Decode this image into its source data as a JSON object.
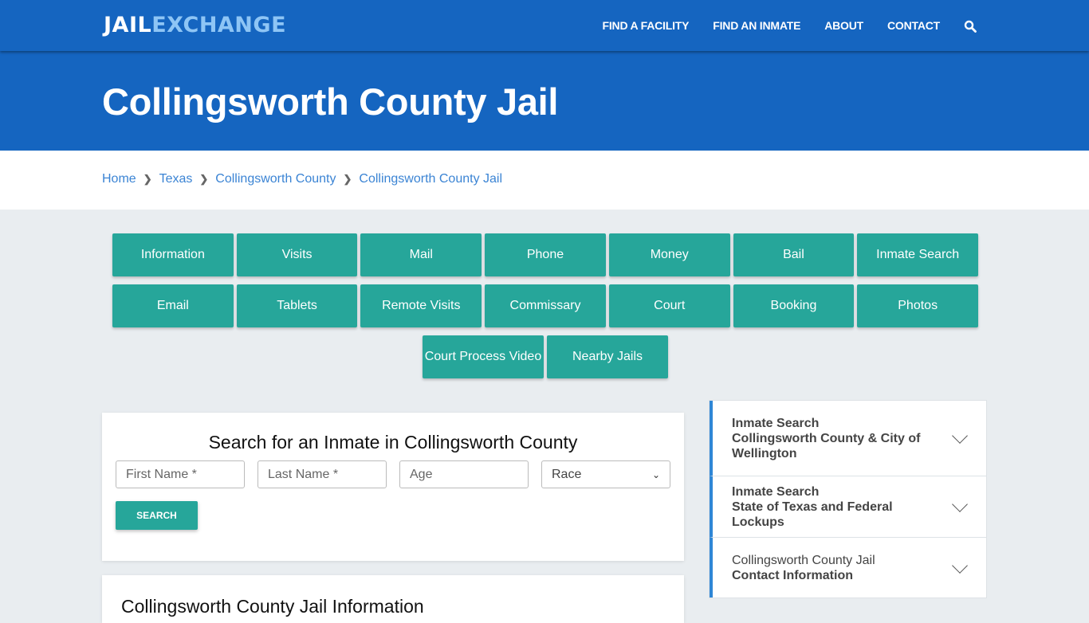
{
  "header": {
    "logo_part1": "JAIL",
    "logo_part2": "EXCHANGE",
    "nav": [
      "FIND A FACILITY",
      "FIND AN INMATE",
      "ABOUT",
      "CONTACT"
    ],
    "search_icon": "search-icon"
  },
  "hero": {
    "title": "Collingsworth County Jail"
  },
  "breadcrumb": [
    "Home",
    "Texas",
    "Collingsworth County",
    "Collingsworth County Jail"
  ],
  "buttons": {
    "row1": [
      "Information",
      "Visits",
      "Mail",
      "Phone",
      "Money",
      "Bail",
      "Inmate Search"
    ],
    "row2": [
      "Email",
      "Tablets",
      "Remote Visits",
      "Commissary",
      "Court",
      "Booking",
      "Photos"
    ],
    "row3": [
      "Court Process Video",
      "Nearby Jails"
    ]
  },
  "search": {
    "title": "Search for an Inmate in Collingsworth County",
    "first_name_placeholder": "First Name *",
    "last_name_placeholder": "Last Name *",
    "age_placeholder": "Age",
    "race_selected": "Race",
    "button": "SEARCH"
  },
  "info": {
    "title": "Collingsworth County Jail Information"
  },
  "sidebar": {
    "items": [
      {
        "line1": "Inmate Search",
        "line2": "Collingsworth County & City of Wellington"
      },
      {
        "line1": "Inmate Search",
        "line2": "State of Texas and Federal Lockups"
      },
      {
        "line1": "Collingsworth County Jail",
        "line2": "Contact Information"
      }
    ]
  }
}
